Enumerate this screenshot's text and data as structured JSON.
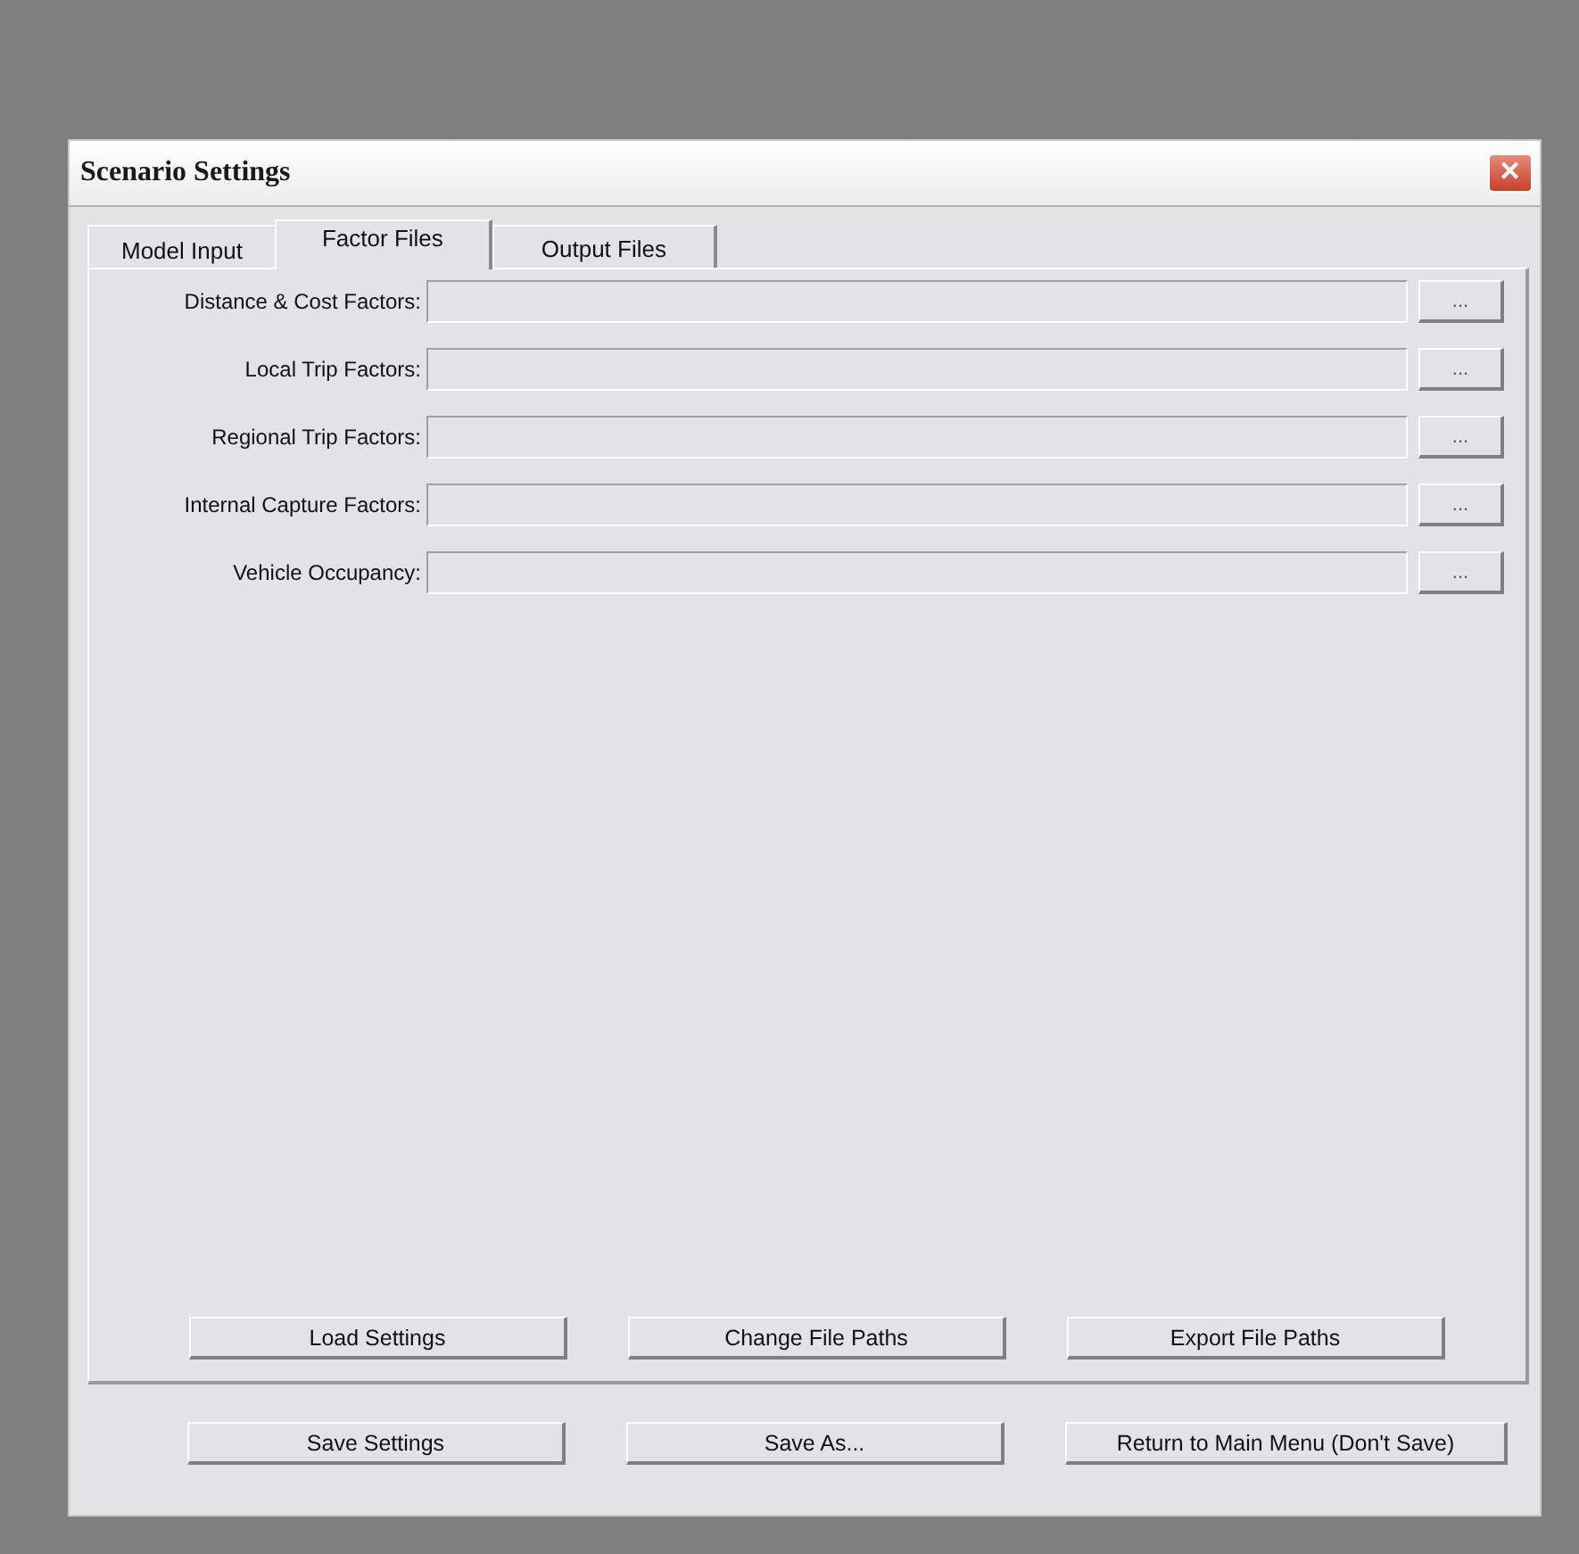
{
  "window": {
    "title": "Scenario Settings",
    "close": "✕"
  },
  "tabs": [
    {
      "label": "Model Input",
      "selected": false
    },
    {
      "label": "Factor Files",
      "selected": true
    },
    {
      "label": "Output Files",
      "selected": false
    }
  ],
  "fields": [
    {
      "label": "Distance & Cost Factors:",
      "browse": "..."
    },
    {
      "label": "Local Trip Factors:",
      "browse": "..."
    },
    {
      "label": "Regional Trip Factors:",
      "browse": "..."
    },
    {
      "label": "Internal Capture Factors:",
      "browse": "..."
    },
    {
      "label": "Vehicle Occupancy:",
      "browse": "..."
    }
  ],
  "panel_buttons": [
    "Load Settings",
    "Change File Paths",
    "Export File Paths"
  ],
  "footer_buttons": [
    "Save Settings",
    "Save As...",
    "Return to Main Menu (Don't Save)"
  ]
}
